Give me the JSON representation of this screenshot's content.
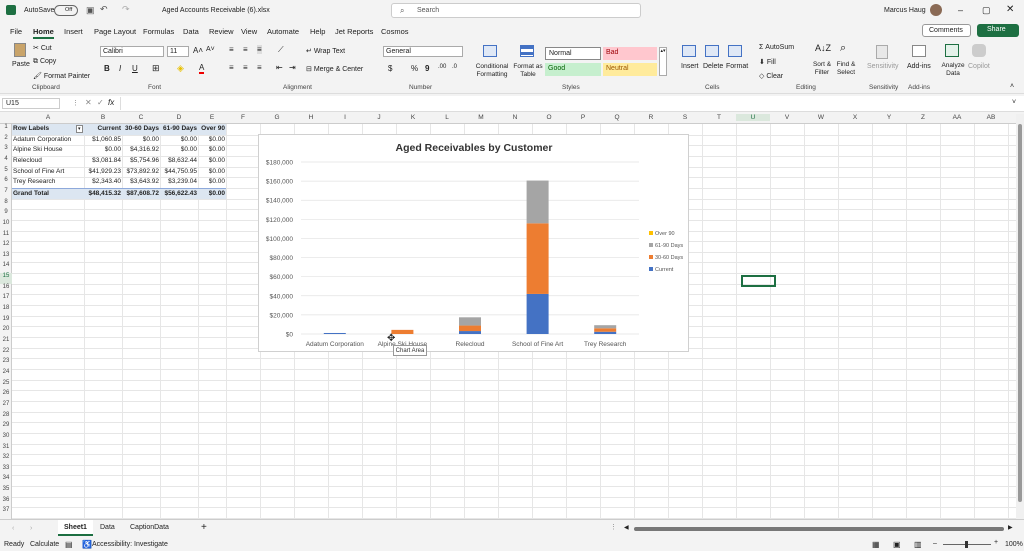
{
  "titlebar": {
    "autosave": "AutoSave",
    "toggle": "Off",
    "filename": "Aged Accounts Receivable (6).xlsx",
    "search_placeholder": "Search",
    "user": "Marcus Haug"
  },
  "menu": [
    "File",
    "Home",
    "Insert",
    "Page Layout",
    "Formulas",
    "Data",
    "Review",
    "View",
    "Automate",
    "Help",
    "Jet Reports",
    "Cosmos"
  ],
  "menu_right": {
    "comments": "Comments",
    "share": "Share"
  },
  "ribbon": {
    "clipboard": {
      "paste": "Paste",
      "cut": "Cut",
      "copy": "Copy",
      "format_painter": "Format Painter",
      "label": "Clipboard"
    },
    "font": {
      "name": "Calibri",
      "size": "11",
      "label": "Font"
    },
    "alignment": {
      "wrap": "Wrap Text",
      "merge": "Merge & Center",
      "label": "Alignment"
    },
    "number": {
      "format": "General",
      "label": "Number"
    },
    "styles": {
      "conditional": "Conditional Formatting",
      "format_table": "Format as Table",
      "normal": "Normal",
      "bad": "Bad",
      "good": "Good",
      "neutral": "Neutral",
      "label": "Styles"
    },
    "cells": {
      "insert": "Insert",
      "delete": "Delete",
      "format": "Format",
      "label": "Cells"
    },
    "editing": {
      "autosum": "AutoSum",
      "fill": "Fill",
      "clear": "Clear",
      "sort": "Sort & Filter",
      "find": "Find & Select",
      "label": "Editing"
    },
    "sensitivity": {
      "btn": "Sensitivity",
      "label": "Sensitivity"
    },
    "addins": {
      "btn": "Add-ins",
      "analyze": "Analyze Data",
      "copilot": "Copilot",
      "label": "Add-ins"
    }
  },
  "formula": {
    "namebox": "U15",
    "fx": "fx"
  },
  "columns": [
    "A",
    "B",
    "C",
    "D",
    "E",
    "F",
    "G",
    "H",
    "I",
    "J",
    "K",
    "L",
    "M",
    "N",
    "O",
    "P",
    "Q",
    "R",
    "S",
    "T",
    "U",
    "V",
    "W",
    "X",
    "Y",
    "Z",
    "AA",
    "AB"
  ],
  "rows": [
    "1",
    "2",
    "3",
    "4",
    "5",
    "6",
    "7",
    "8",
    "9",
    "10",
    "11",
    "12",
    "13",
    "14",
    "15",
    "16",
    "17",
    "18",
    "19",
    "20",
    "21",
    "22",
    "23",
    "24",
    "25",
    "26",
    "27",
    "28",
    "29",
    "30",
    "31",
    "32",
    "33",
    "34",
    "35",
    "36",
    "37"
  ],
  "pivot": {
    "headers": [
      "Row Labels",
      "Current",
      "30-60 Days",
      "61-90 Days",
      "Over 90"
    ],
    "rows": [
      [
        "Adatum Corporation",
        "$1,060.85",
        "$0.00",
        "$0.00",
        "$0.00"
      ],
      [
        "Alpine Ski House",
        "$0.00",
        "$4,316.92",
        "$0.00",
        "$0.00"
      ],
      [
        "Relecloud",
        "$3,081.84",
        "$5,754.96",
        "$8,632.44",
        "$0.00"
      ],
      [
        "School of Fine Art",
        "$41,929.23",
        "$73,892.92",
        "$44,750.95",
        "$0.00"
      ],
      [
        "Trey Research",
        "$2,343.40",
        "$3,643.92",
        "$3,239.04",
        "$0.00"
      ]
    ],
    "total": [
      "Grand Total",
      "$48,415.32",
      "$87,608.72",
      "$56,622.43",
      "$0.00"
    ]
  },
  "chart_data": {
    "type": "bar",
    "stacked": true,
    "title": "Aged Receivables by Customer",
    "categories": [
      "Adatum Corporation",
      "Alpine Ski House",
      "Relecloud",
      "School of Fine Art",
      "Trey Research"
    ],
    "series": [
      {
        "name": "Current",
        "color": "#4472c4",
        "values": [
          1060.85,
          0,
          3081.84,
          41929.23,
          2343.4
        ]
      },
      {
        "name": "30-60 Days",
        "color": "#ed7d31",
        "values": [
          0,
          4316.92,
          5754.96,
          73892.92,
          3643.92
        ]
      },
      {
        "name": "61-90 Days",
        "color": "#a5a5a5",
        "values": [
          0,
          0,
          8632.44,
          44750.95,
          3239.04
        ]
      },
      {
        "name": "Over 90",
        "color": "#ffc000",
        "values": [
          0,
          0,
          0,
          0,
          0
        ]
      }
    ],
    "yticks": [
      "$0",
      "$20,000",
      "$40,000",
      "$60,000",
      "$80,000",
      "$100,000",
      "$120,000",
      "$140,000",
      "$160,000",
      "$180,000"
    ],
    "ylim": [
      0,
      180000
    ],
    "legend_position": "right",
    "tooltip": "Chart Area"
  },
  "sheets": [
    "Sheet1",
    "Data",
    "CaptionData"
  ],
  "status": {
    "ready": "Ready",
    "calculate": "Calculate",
    "accessibility": "Accessibility: Investigate",
    "zoom": "100%"
  }
}
